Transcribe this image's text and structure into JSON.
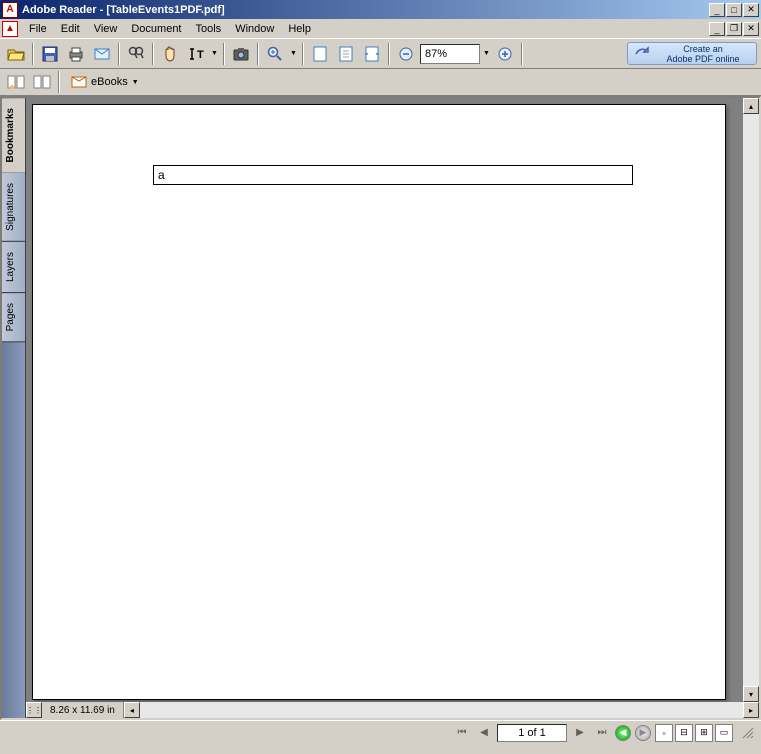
{
  "window": {
    "title": "Adobe Reader - [TableEvents1PDF.pdf]"
  },
  "menu": {
    "items": [
      "File",
      "Edit",
      "View",
      "Document",
      "Tools",
      "Window",
      "Help"
    ]
  },
  "toolbar": {
    "zoom": "87%",
    "promo": {
      "line1": "Create an",
      "line2": "Adobe PDF online"
    }
  },
  "toolbar2": {
    "ebooks_label": "eBooks"
  },
  "sidetabs": [
    "Bookmarks",
    "Signatures",
    "Layers",
    "Pages"
  ],
  "document": {
    "cell_text": "a"
  },
  "hscroll": {
    "dimensions": "8.26 x 11.69 in"
  },
  "status": {
    "page_display": "1 of 1"
  }
}
